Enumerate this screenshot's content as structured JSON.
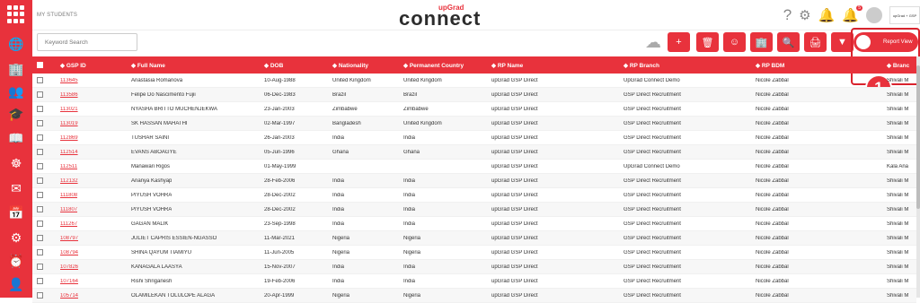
{
  "app": {
    "breadcrumb": "MY STUDENTS",
    "logo_top": "upGrad",
    "logo_main": "connect",
    "notification_count": "5",
    "brand_label": "upGrad + GSP"
  },
  "toolbar": {
    "search_placeholder": "Keyword Search",
    "report_view_label": "Report View",
    "callout_number": "1"
  },
  "table": {
    "headers": {
      "id": "GSP ID",
      "name": "Full Name",
      "dob": "DOB",
      "nat": "Nationality",
      "pc": "Permanent Country",
      "rp": "RP Name",
      "br": "RP Branch",
      "bdm": "RP BDM",
      "brn": "Branc"
    },
    "rows": [
      {
        "id": "113645",
        "name": "Anastasia Romanova",
        "dob": "10-Aug-1988",
        "nat": "United Kingdom",
        "pc": "United Kingdom",
        "rp": "upGrad GSP Direct",
        "br": "UpGrad Connect Demo",
        "bdm": "Nicole Zabbal",
        "brn": "Shivali M"
      },
      {
        "id": "113586",
        "name": "Felipe Do Nascimento Fujii",
        "dob": "06-Dec-1983",
        "nat": "Brazil",
        "pc": "Brazil",
        "rp": "upGrad GSP Direct",
        "br": "GSP Direct Recruitment",
        "bdm": "Nicole Zabbal",
        "brn": "Shivali M"
      },
      {
        "id": "113021",
        "name": "NYASHA BRITTO MUCHENJEKWA",
        "dob": "23-Jan-2003",
        "nat": "Zimbabwe",
        "pc": "Zimbabwe",
        "rp": "upGrad GSP Direct",
        "br": "GSP Direct Recruitment",
        "bdm": "Nicole Zabbal",
        "brn": "Shivali M"
      },
      {
        "id": "113019",
        "name": "SK HASSAN MAHATHI",
        "dob": "02-Mar-1997",
        "nat": "Bangladesh",
        "pc": "United Kingdom",
        "rp": "upGrad GSP Direct",
        "br": "GSP Direct Recruitment",
        "bdm": "Nicole Zabbal",
        "brn": "Shivali M"
      },
      {
        "id": "112869",
        "name": "TUSHAR SAINI",
        "dob": "26-Jan-2003",
        "nat": "India",
        "pc": "India",
        "rp": "upGrad GSP Direct",
        "br": "GSP Direct Recruitment",
        "bdm": "Nicole Zabbal",
        "brn": "Shivali M"
      },
      {
        "id": "112514",
        "name": "EVANS ABOAGYE",
        "dob": "05-Jun-1996",
        "nat": "Ghana",
        "pc": "Ghana",
        "rp": "upGrad GSP Direct",
        "br": "GSP Direct Recruitment",
        "bdm": "Nicole Zabbal",
        "brn": "Shivali M"
      },
      {
        "id": "112511",
        "name": "Manawari Rigos",
        "dob": "01-May-1999",
        "nat": "",
        "pc": "",
        "rp": "upGrad GSP Direct",
        "br": "UpGrad Connect Demo",
        "bdm": "Nicole Zabbal",
        "brn": "Kala Ana"
      },
      {
        "id": "112132",
        "name": "Ananya Kashyap",
        "dob": "28-Feb-2006",
        "nat": "India",
        "pc": "India",
        "rp": "upGrad GSP Direct",
        "br": "GSP Direct Recruitment",
        "bdm": "Nicole Zabbal",
        "brn": "Shivali M"
      },
      {
        "id": "111808",
        "name": "PIYUSH VOHRA",
        "dob": "28-Dec-2002",
        "nat": "India",
        "pc": "India",
        "rp": "upGrad GSP Direct",
        "br": "GSP Direct Recruitment",
        "bdm": "Nicole Zabbal",
        "brn": "Shivali M"
      },
      {
        "id": "111807",
        "name": "PIYUSH VOHRA",
        "dob": "28-Dec-2002",
        "nat": "India",
        "pc": "India",
        "rp": "upGrad GSP Direct",
        "br": "GSP Direct Recruitment",
        "bdm": "Nicole Zabbal",
        "brn": "Shivali M"
      },
      {
        "id": "111267",
        "name": "GAGAN MALIK",
        "dob": "23-Sep-1998",
        "nat": "India",
        "pc": "India",
        "rp": "upGrad GSP Direct",
        "br": "GSP Direct Recruitment",
        "bdm": "Nicole Zabbal",
        "brn": "Shivali M"
      },
      {
        "id": "108797",
        "name": "JULIET CAPRIS ESSIEN-NGASSO",
        "dob": "11-Mar-2021",
        "nat": "Nigeria",
        "pc": "Nigeria",
        "rp": "upGrad GSP Direct",
        "br": "GSP Direct Recruitment",
        "bdm": "Nicole Zabbal",
        "brn": "Shivali M"
      },
      {
        "id": "108794",
        "name": "SHINA QAYUM TIAMIYU",
        "dob": "11-Jun-2005",
        "nat": "Nigeria",
        "pc": "Nigeria",
        "rp": "upGrad GSP Direct",
        "br": "GSP Direct Recruitment",
        "bdm": "Nicole Zabbal",
        "brn": "Shivali M"
      },
      {
        "id": "107826",
        "name": "KANAGALA LAASYA",
        "dob": "15-Nov-2007",
        "nat": "India",
        "pc": "India",
        "rp": "upGrad GSP Direct",
        "br": "GSP Direct Recruitment",
        "bdm": "Nicole Zabbal",
        "brn": "Shivali M"
      },
      {
        "id": "107164",
        "name": "Rishi Shriganesh",
        "dob": "19-Feb-2006",
        "nat": "India",
        "pc": "India",
        "rp": "upGrad GSP Direct",
        "br": "GSP Direct Recruitment",
        "bdm": "Nicole Zabbal",
        "brn": "Shivali M"
      },
      {
        "id": "105714",
        "name": "OLAMILEKAN TOLULOPE ALAGA",
        "dob": "20-Apr-1999",
        "nat": "Nigeria",
        "pc": "Nigeria",
        "rp": "upGrad GSP Direct",
        "br": "GSP Direct Recruitment",
        "bdm": "Nicole Zabbal",
        "brn": "Shivali M"
      }
    ]
  },
  "colors": {
    "accent": "#e8323c"
  },
  "icons": {
    "sidebar": [
      "globe-icon",
      "building-icon",
      "users-icon",
      "graduation-cap-icon",
      "book-icon",
      "hand-coin-icon",
      "mail-icon",
      "calendar-icon",
      "settings-icon",
      "clock-icon",
      "user-badge-icon"
    ],
    "toolbar": [
      "cloud-icon",
      "plus-icon",
      "trash-icon",
      "user-circle-icon",
      "building-plus-icon",
      "search-zoom-icon",
      "printer-icon",
      "filter-icon"
    ],
    "top": [
      "help-icon",
      "settings-icon",
      "bell-icon",
      "notification-icon",
      "avatar"
    ]
  }
}
